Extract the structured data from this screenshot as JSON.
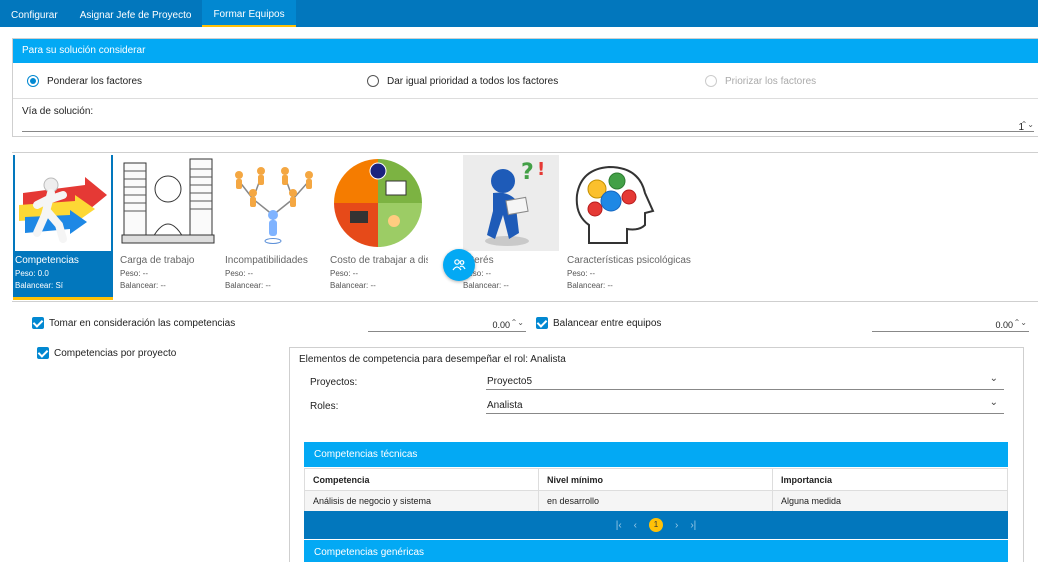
{
  "tabs": [
    "Configurar",
    "Asignar Jefe de Proyecto",
    "Formar Equipos"
  ],
  "solution_panel": {
    "title": "Para su solución considerar",
    "options": [
      "Ponderar los factores",
      "Dar igual prioridad a todos los factores",
      "Priorizar los factores"
    ],
    "via_label": "Vía de solución:",
    "via_value": "1"
  },
  "factors": [
    {
      "name": "Competencias",
      "weight": "Peso: 0.0",
      "balance": "Balancear: Sí",
      "icon": "running-man-arrows-icon"
    },
    {
      "name": "Carga de trabajo",
      "weight": "Peso: --",
      "balance": "Balancear: --",
      "icon": "overloaded-worker-icon"
    },
    {
      "name": "Incompatibilidades",
      "weight": "Peso: --",
      "balance": "Balancear: --",
      "icon": "network-people-icon"
    },
    {
      "name": "Costo de trabajar a distancia",
      "weight": "Peso: --",
      "balance": "Balancear: --",
      "icon": "remote-work-icon"
    },
    {
      "name": "Interés",
      "weight": "Peso: --",
      "balance": "Balancear: --",
      "icon": "question-figure-icon"
    },
    {
      "name": "Características psicológicas",
      "weight": "Peso: --",
      "balance": "Balancear: --",
      "icon": "head-gears-icon"
    }
  ],
  "options": {
    "consider_label": "Tomar en consideración las competencias",
    "consider_value": "0.00",
    "balance_label": "Balancear entre equipos",
    "balance_value": "0.00",
    "per_project_label": "Competencias por proyecto"
  },
  "detail": {
    "title": "Elementos de competencia para desempeñar el rol: Analista",
    "projects_label": "Proyectos:",
    "projects_value": "Proyecto5",
    "roles_label": "Roles:",
    "roles_value": "Analista",
    "technical_title": "Competencias técnicas",
    "columns": [
      "Competencia",
      "Nivel mínimo",
      "Importancia"
    ],
    "rows": [
      [
        "Análisis de negocio y sistema",
        "en desarrollo",
        "Alguna medida"
      ]
    ],
    "page": "1",
    "generic_title": "Competencias genéricas"
  },
  "colors": {
    "primary": "#0277bd",
    "accent": "#03a9f4",
    "highlight": "#ffc107"
  }
}
